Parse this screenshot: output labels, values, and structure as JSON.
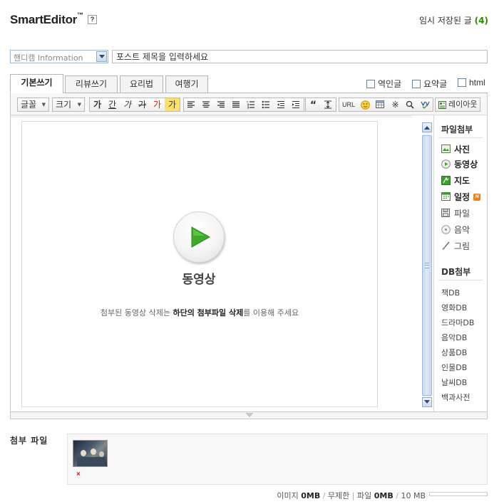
{
  "header": {
    "logo_text": "SmartEditor",
    "logo_tm": "™",
    "help_label": "?",
    "autosave_label": "임시 저장된 글",
    "autosave_count": "(4)"
  },
  "post": {
    "category_value": "핸디캠 Information",
    "title_placeholder": "포스트 제목을 입력하세요"
  },
  "tabs": [
    {
      "label": "기본쓰기",
      "active": true
    },
    {
      "label": "리뷰쓰기",
      "active": false
    },
    {
      "label": "요리법",
      "active": false
    },
    {
      "label": "여행기",
      "active": false
    }
  ],
  "options": {
    "translate_label": "역인글",
    "summary_label": "요약글",
    "html_label": "html"
  },
  "toolbar": {
    "font_label": "글꼴",
    "size_label": "크기",
    "bold_glyph": "가",
    "underline_glyph": "간",
    "italic_glyph": "가",
    "strike_glyph": "가",
    "color_glyph": "가",
    "bgcolor_glyph": "가",
    "url_label": "URL",
    "special_char": "※",
    "layout_label": "레이아웃"
  },
  "editor": {
    "video_label": "동영상",
    "notice_pre": "첨부된 동영상 삭제는 ",
    "notice_bold": "하단의 첨부파일 삭제",
    "notice_post": "를 이용해 주세요"
  },
  "side_panel": {
    "attach_heading": "파일첨부",
    "attach_items": [
      "사진",
      "동영상",
      "지도",
      "일정",
      "파일",
      "음악",
      "그림"
    ],
    "new_badge": "N",
    "db_heading": "DB첨부",
    "db_items": [
      "책DB",
      "영화DB",
      "드라마DB",
      "음악DB",
      "상품DB",
      "인물DB",
      "날씨DB",
      "백과사전"
    ]
  },
  "attachments": {
    "label": "첨부 파일",
    "delete_glyph": "×"
  },
  "quota": {
    "image_label": "이미지",
    "image_value": "0MB",
    "image_limit": "무제한",
    "file_label": "파일",
    "file_value": "0MB",
    "file_limit": "10 MB",
    "file_fill": 0
  },
  "colors": {
    "accent_green": "#2b8a00",
    "scroll_blue": "#c9d8f0",
    "play_green": "#3faa2a",
    "new_badge": "#f08020"
  }
}
